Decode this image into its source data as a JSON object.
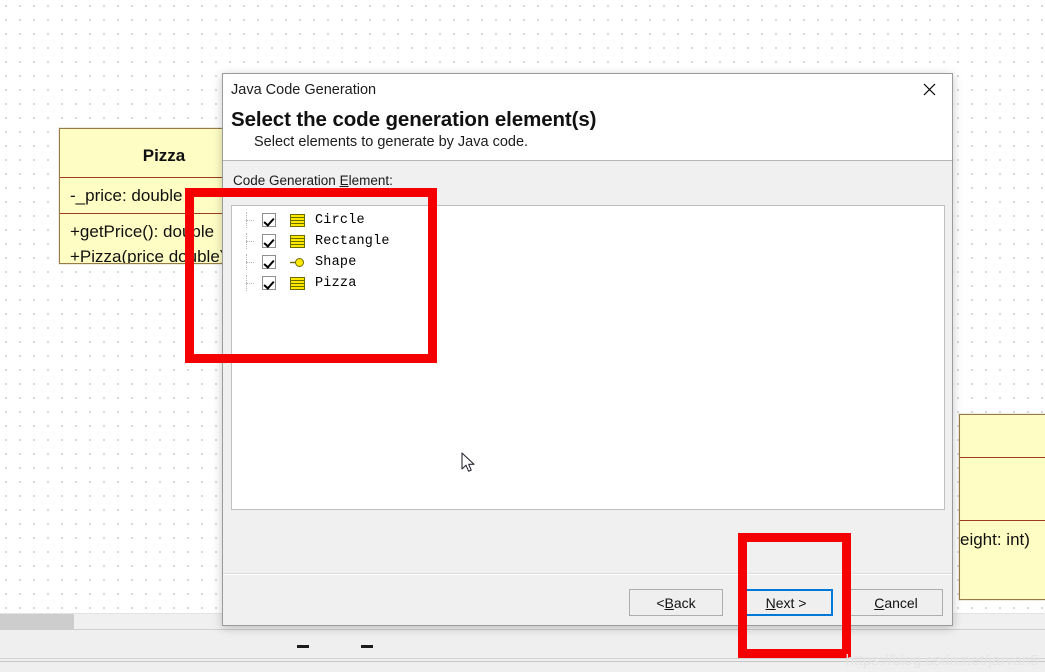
{
  "dialog": {
    "window_title": "Java Code Generation",
    "heading": "Select the code generation element(s)",
    "subheading": "Select elements to generate by Java code.",
    "close_icon": "close-icon",
    "list_label_prefix": "Code Generation ",
    "list_label_accel": "E",
    "list_label_suffix": "lement:",
    "elements": [
      {
        "label": "Circle",
        "icon": "uml-class-icon",
        "checked": true
      },
      {
        "label": "Rectangle",
        "icon": "uml-class-icon",
        "checked": true
      },
      {
        "label": "Shape",
        "icon": "uml-interface-icon",
        "checked": true
      },
      {
        "label": "Pizza",
        "icon": "uml-class-icon",
        "checked": true
      }
    ],
    "buttons": [
      {
        "name": "back",
        "pre": "< ",
        "accel": "B",
        "post": "ack",
        "primary": false
      },
      {
        "name": "next",
        "pre": "",
        "accel": "N",
        "post": "ext >",
        "primary": true
      },
      {
        "name": "cancel",
        "pre": "",
        "accel": "C",
        "post": "ancel",
        "primary": false
      }
    ]
  },
  "canvas": {
    "pizza_class": {
      "title": "Pizza",
      "attributes": [
        "-_price: double"
      ],
      "operations": [
        "+getPrice(): double",
        "+Pizza(price double)"
      ]
    },
    "right_class": {
      "operations_visible": "eight: int)"
    }
  },
  "annotations": [
    {
      "name": "annotation-code-generation-element",
      "color": "#f40000"
    },
    {
      "name": "annotation-next-button",
      "color": "#f40000"
    }
  ],
  "watermark": {
    "text": "https://blog.csdn.net/jarvan5"
  },
  "colors": {
    "accent": "#0078d7",
    "annotation_red": "#f40000",
    "uml_fill": "#fdfdc4",
    "uml_border": "#9a7b46",
    "uml_separator": "#9e3b20",
    "dialog_bg": "#f0f0f0"
  }
}
